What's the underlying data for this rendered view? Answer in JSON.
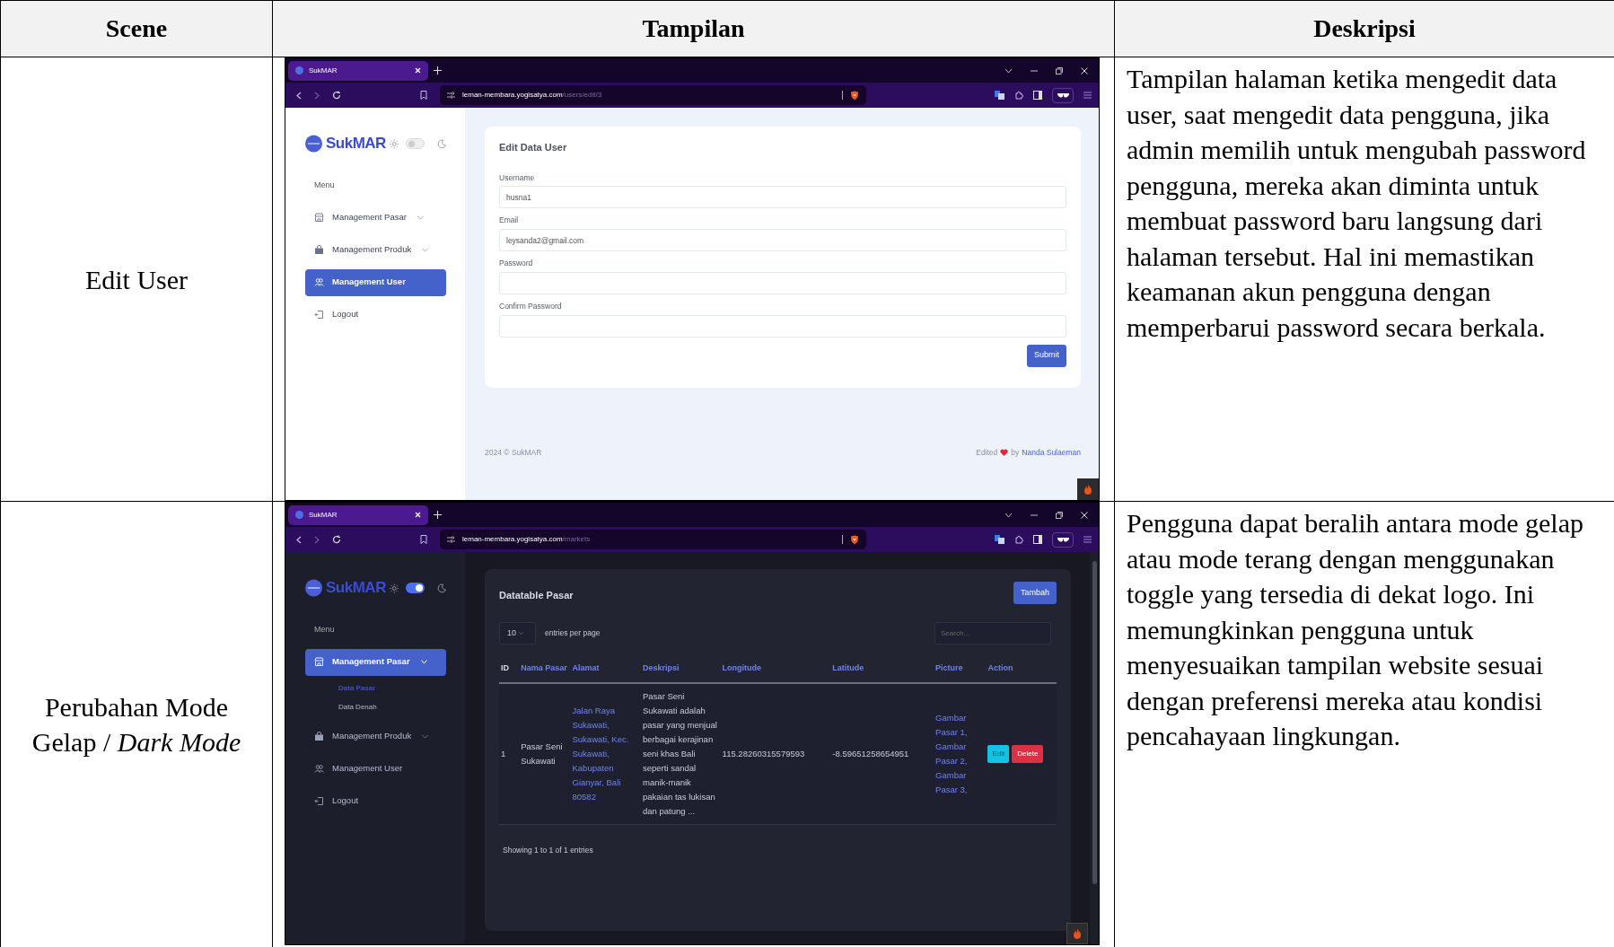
{
  "table": {
    "columns": [
      "Scene",
      "Tampilan",
      "Deskripsi"
    ],
    "rows": [
      {
        "scene": "Edit User",
        "description": "Tampilan halaman ketika mengedit data user, saat mengedit data pengguna, jika admin memilih untuk mengubah password pengguna, mereka akan diminta untuk membuat password baru langsung dari halaman tersebut. Hal ini memastikan keamanan akun pengguna dengan memperbarui password secara berkala.",
        "screenshot": {
          "kind": "light",
          "tab_title": "SukMAR",
          "url_host": "leman-membara.yogisatya.com",
          "url_path": "/users/edit/3",
          "logo": "SukMAR",
          "dark_toggle_on": false,
          "sidebar": {
            "menu_label": "Menu",
            "items": [
              {
                "label": "Management Pasar",
                "kind": "store",
                "selected": false,
                "submenu": true
              },
              {
                "label": "Management Produk",
                "kind": "bag",
                "selected": false,
                "submenu": true
              },
              {
                "label": "Management User",
                "kind": "users",
                "selected": true,
                "submenu": false
              },
              {
                "label": "Logout",
                "kind": "logout",
                "selected": false,
                "submenu": false
              }
            ]
          },
          "content": {
            "kind": "form",
            "title": "Edit Data User",
            "fields": [
              {
                "label": "Username",
                "value": "husna1"
              },
              {
                "label": "Email",
                "value": "leysanda2@gmail.com"
              },
              {
                "label": "Password"
              },
              {
                "label": "Confirm Password"
              }
            ],
            "submit": "Submit",
            "footer": {
              "left": "2024 © SukMAR",
              "prefix": "Edited",
              "middle": "by",
              "link": "Nanda Sulaeman"
            }
          }
        }
      },
      {
        "scene": "Perubahan Mode Gelap / *Dark Mode*",
        "description": "Pengguna dapat beralih antara mode gelap atau mode terang dengan menggunakan toggle yang tersedia di dekat logo. Ini memungkinkan pengguna untuk menyesuaikan tampilan website sesuai dengan preferensi mereka atau kondisi pencahayaan lingkungan.",
        "screenshot": {
          "kind": "dark",
          "tab_title": "SukMAR",
          "url_host": "leman-membara.yogisatya.com",
          "url_path": "/markets",
          "logo": "SukMAR",
          "dark_toggle_on": true,
          "sidebar": {
            "menu_label": "Menu",
            "items": [
              {
                "label": "Management Pasar",
                "kind": "store",
                "selected": true,
                "submenu": true,
                "expanded": true,
                "children": [
                  {
                    "label": "Data Pasar",
                    "selected": true
                  },
                  {
                    "label": "Data Denah",
                    "selected": false
                  }
                ]
              },
              {
                "label": "Management Produk",
                "kind": "bag",
                "selected": false,
                "submenu": true
              },
              {
                "label": "Management User",
                "kind": "users",
                "selected": false,
                "submenu": false
              },
              {
                "label": "Logout",
                "kind": "logout",
                "selected": false,
                "submenu": false
              }
            ]
          },
          "content": {
            "kind": "datatable",
            "title": "Datatable Pasar",
            "add_button": "Tambah",
            "page_size": "10",
            "entries_label": "entries per page",
            "search_placeholder": "Search...",
            "columns": [
              {
                "label": "ID",
                "kind": "text"
              },
              {
                "label": "Nama Pasar",
                "kind": "text"
              },
              {
                "label": "Alamat",
                "kind": "link"
              },
              {
                "label": "Deskripsi",
                "kind": "text"
              },
              {
                "label": "Longitude",
                "kind": "text"
              },
              {
                "label": "Latitude",
                "kind": "text"
              },
              {
                "label": "Picture",
                "kind": "links"
              },
              {
                "label": "Action",
                "kind": "actions"
              }
            ],
            "rows": [
              {
                "cells": [
                  "1",
                  "Pasar Seni Sukawati",
                  "Jalan Raya Sukawati, Sukawati, Kec. Sukawati, Kabupaten Gianyar, Bali 80582",
                  "Pasar Seni Sukawati adalah pasar yang menjual berbagai kerajinan seni khas Bali seperti sandal manik-manik pakaian tas lukisan dan patung ...",
                  "115.28260315579593",
                  "-8.59651258654951",
                  [
                    "Gambar Pasar 1,",
                    "Gambar Pasar 2,",
                    "Gambar Pasar 3,"
                  ],
                  [
                    {
                      "label": "Edit",
                      "kind": "edit"
                    },
                    {
                      "label": "Delete",
                      "kind": "delete"
                    }
                  ]
                ]
              }
            ],
            "info": "Showing 1 to 1 of 1 entries"
          }
        }
      }
    ]
  }
}
